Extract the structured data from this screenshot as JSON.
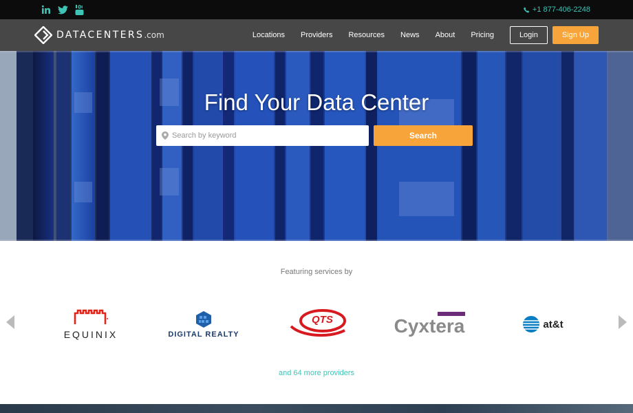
{
  "topbar": {
    "social": [
      "linkedin-icon",
      "twitter-icon",
      "youtube-icon"
    ],
    "phone": "+1 877-406-2248"
  },
  "header": {
    "logo_main": "DATACENTERS",
    "logo_domain": ".com",
    "nav": [
      "Locations",
      "Providers",
      "Resources",
      "News",
      "About",
      "Pricing"
    ],
    "login_label": "Login",
    "signup_label": "Sign Up"
  },
  "hero": {
    "title": "Find Your Data Center",
    "search_placeholder": "Search by keyword",
    "search_button": "Search"
  },
  "featuring": {
    "title": "Featuring services by",
    "providers": {
      "equinix": "EQUINIX",
      "digital_realty": "DIGITAL REALTY",
      "qts": "QTS",
      "cyxtera": "Cyxtera",
      "att": "at&t"
    },
    "more_link": "and 64 more providers"
  },
  "colors": {
    "accent_orange": "#f7a53a",
    "accent_teal": "#3fc3b5",
    "nav_bg": "#474747",
    "topbar_bg": "#0c0c0c",
    "equinix_red": "#e2231a",
    "digital_realty_blue": "#1f5ea8",
    "qts_red": "#d71920",
    "cyxtera_purple": "#6b2a7a"
  }
}
